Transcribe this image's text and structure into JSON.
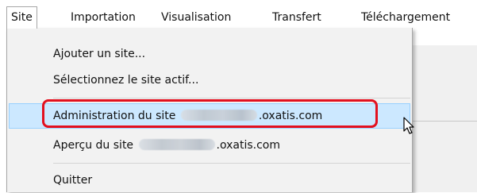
{
  "menubar": {
    "items": [
      {
        "label": "Site"
      },
      {
        "label": "Importation"
      },
      {
        "label": "Visualisation"
      },
      {
        "label": "Transfert"
      },
      {
        "label": "Téléchargement"
      }
    ]
  },
  "dropdown": {
    "items": [
      {
        "label": "Ajouter un site..."
      },
      {
        "label": "Sélectionnez le site actif..."
      },
      {
        "label_prefix": "Administration du site",
        "label_suffix": ".oxatis.com"
      },
      {
        "label_prefix": "Aperçu du site",
        "label_suffix": ".oxatis.com"
      },
      {
        "label": "Quitter"
      }
    ]
  },
  "colors": {
    "highlight_bg": "#cce8ff",
    "highlight_border": "#99d1ff",
    "annotation_red": "#e3101f",
    "menu_bg": "#f2f2f2"
  },
  "icons": {
    "cursor": "mouse-pointer-icon"
  }
}
